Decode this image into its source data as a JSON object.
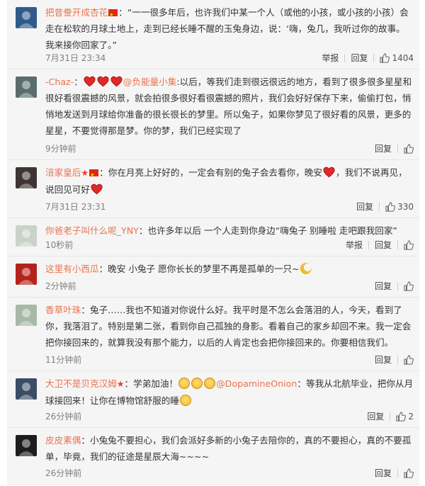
{
  "comments": [
    {
      "name": "把昔誊开成杏花",
      "parts": [
        {
          "t": "text",
          "v": "：“一一很多年后，也许我们中某一个人（或他的小孩，或小孩的小孩）会走在松软的月球土地上，走到已经长睡不醒的玉兔身边，说：‘嗨，兔几，我听过你的故事。我来接你回家了。”"
        }
      ],
      "time": "7月31日 23:34",
      "report": "举报",
      "reply": "回复",
      "likes": "1404",
      "colors": {
        "avatar": "#2f5b8a"
      }
    },
    {
      "name": "-Chaz-",
      "parts": [
        {
          "t": "text",
          "v": "："
        },
        {
          "t": "heart"
        },
        {
          "t": "heart"
        },
        {
          "t": "heart"
        },
        {
          "t": "mention",
          "v": "@负能量小集"
        },
        {
          "t": "text",
          "v": ":以后，等我们走到很远很远的地方，看到了很多很多星星和很好看很震撼的风景，就会拍很多很好看很震撼的照片，我们会好好保存下来，偷偷打包，悄悄地发送到月球给你准备的很长很长的梦里。所以兔子，如果你梦见了很好看的风景，更多的星星，不要觉得那是梦。你的梦，我们已经实现了"
        }
      ],
      "time": "9分钟前",
      "reply": "回复",
      "colors": {
        "avatar": "#5b6c6e"
      }
    },
    {
      "name": "涪家皇后",
      "parts": [
        {
          "t": "text",
          "v": "：你在月亮上好好的，一定会有别的兔子会去看你，晚安"
        },
        {
          "t": "heart"
        },
        {
          "t": "text",
          "v": "，我们不说再见，说回见可好"
        },
        {
          "t": "heart"
        }
      ],
      "time": "7月31日 23:31",
      "reply": "回复",
      "likes": "330",
      "colors": {
        "avatar": "#3d3433"
      }
    },
    {
      "name": "你爸老子叫什么呢_YNY",
      "parts": [
        {
          "t": "text",
          "v": "：也许多年以后 一个人走到你身边“嗨兔子 别睡啦 走吧跟我回家”"
        }
      ],
      "time": "10秒前",
      "report": "举报",
      "reply": "回复",
      "colors": {
        "avatar": "#c9d3c8"
      }
    },
    {
      "name": "这里有小西瓜",
      "parts": [
        {
          "t": "text",
          "v": "：晚安 小兔子 愿你长长的梦里不再是孤单的一只~"
        },
        {
          "t": "moon"
        }
      ],
      "time": "2分钟前",
      "reply": "回复",
      "colors": {
        "avatar": "#b4231b"
      }
    },
    {
      "name": "香草叶珠",
      "parts": [
        {
          "t": "text",
          "v": "：兔子……我也不知道对你说什么好。我平时是不怎么会落泪的人，今天，看到了你，我落泪了。特别是第二张，看到你自己孤独的身影。看着自己的家乡却回不来。我一定会把你接回来的，就算我没有那个能力，以后的人肯定也会把你接回来的。你要相信我们。"
        }
      ],
      "time": "11分钟前",
      "reply": "回复",
      "colors": {
        "avatar": "#a7b9a6"
      }
    },
    {
      "name": "大卫不是贝克汉姆",
      "parts": [
        {
          "t": "text",
          "v": "：学弟加油！"
        },
        {
          "t": "face"
        },
        {
          "t": "face"
        },
        {
          "t": "face"
        },
        {
          "t": "mention",
          "v": "@DopamineOnion"
        },
        {
          "t": "text",
          "v": "：等我从北航毕业，把你从月球接回来！让你在博物馆舒服的睡"
        },
        {
          "t": "face"
        }
      ],
      "time": "26分钟前",
      "reply": "回复",
      "likes": "2",
      "colors": {
        "avatar": "#3b4d66"
      }
    },
    {
      "name": "皮皮素偶",
      "parts": [
        {
          "t": "text",
          "v": "：小兔兔不要担心，我们会派好多新的小兔子去陪你的，真的不要担心，真的不要孤单，毕竟，我们的征途是星辰大海~~~~"
        }
      ],
      "time": "26分钟前",
      "reply": "回复",
      "colors": {
        "avatar": "#1d1d1d"
      }
    }
  ]
}
